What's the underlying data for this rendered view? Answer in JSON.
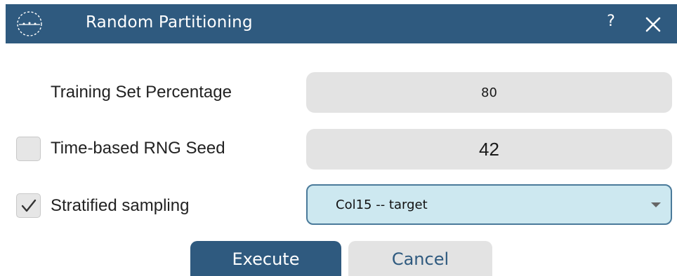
{
  "window": {
    "title": "Random Partitioning",
    "help_label": "?",
    "titlebar_color": "#2f5a7f",
    "logo_icon": "app-logo-icon",
    "close_icon": "close-icon"
  },
  "training_set": {
    "label": "Training Set Percentage",
    "value": "80"
  },
  "rng_seed": {
    "label": "Time-based RNG Seed",
    "checked": false,
    "value": "42"
  },
  "stratified": {
    "label": "Stratified sampling",
    "checked": true,
    "selected_option": "Col15 -- target",
    "caret_icon": "chevron-down-icon"
  },
  "buttons": {
    "execute": "Execute",
    "cancel": "Cancel"
  },
  "colors": {
    "accent": "#2f5a7f",
    "field_bg": "#e3e3e3",
    "select_bg": "#cde8f0"
  }
}
